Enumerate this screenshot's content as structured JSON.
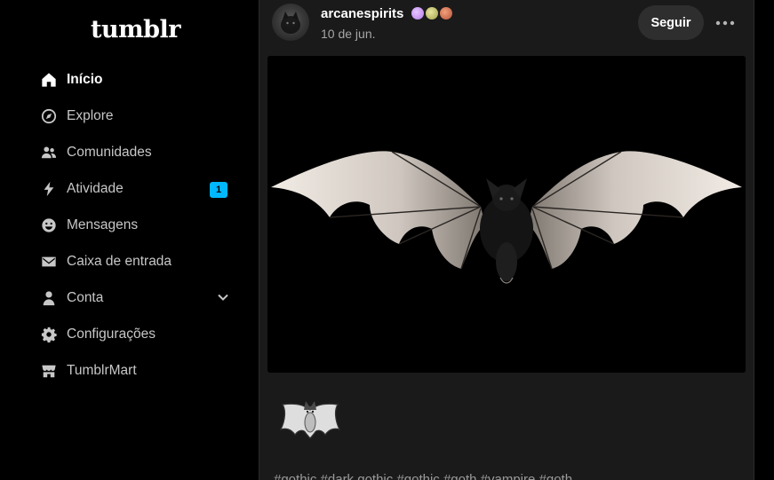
{
  "sidebar": {
    "logo": "tumblr",
    "items": [
      {
        "label": "Início",
        "icon": "home-icon"
      },
      {
        "label": "Explore",
        "icon": "compass-icon"
      },
      {
        "label": "Comunidades",
        "icon": "community-icon"
      },
      {
        "label": "Atividade",
        "icon": "lightning-icon",
        "badge": "1"
      },
      {
        "label": "Mensagens",
        "icon": "smiley-icon"
      },
      {
        "label": "Caixa de entrada",
        "icon": "envelope-icon"
      },
      {
        "label": "Conta",
        "icon": "person-icon"
      },
      {
        "label": "Configurações",
        "icon": "gear-icon"
      },
      {
        "label": "TumblrMart",
        "icon": "shop-icon"
      }
    ]
  },
  "post": {
    "username": "arcanespirits",
    "date": "10 de jun.",
    "follow_label": "Seguir",
    "tags": "#gothic #dark gothic #gothic #goth #vampire #goth"
  },
  "colors": {
    "accent_badge": "#00b8ff",
    "background": "#000000",
    "card": "#1a1a1a"
  }
}
